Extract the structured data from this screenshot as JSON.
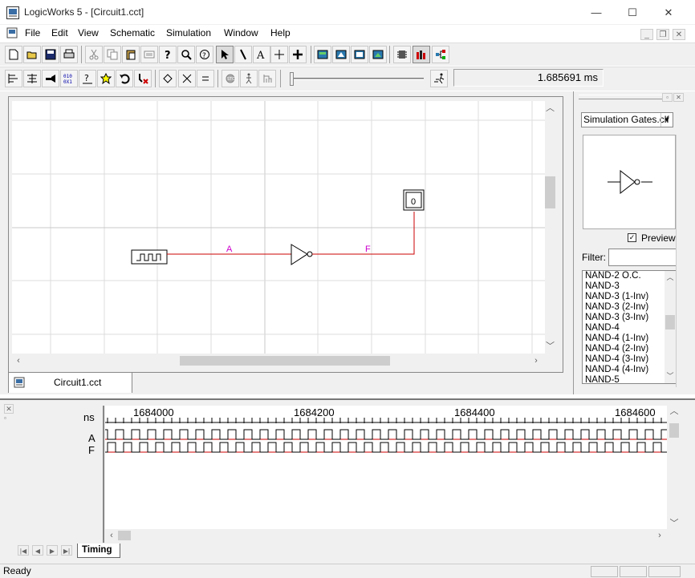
{
  "window": {
    "title": "LogicWorks 5 - [Circuit1.cct]",
    "minimize_label": "—",
    "maximize_label": "☐",
    "close_label": "✕"
  },
  "menu": {
    "items": [
      "File",
      "Edit",
      "View",
      "Schematic",
      "Simulation",
      "Window",
      "Help"
    ]
  },
  "mdi_controls": [
    "_",
    "❐",
    "✕"
  ],
  "toolbar1": {
    "buttons": [
      "new-icon",
      "open-icon",
      "save-icon",
      "print-icon",
      "cut-icon",
      "copy-icon",
      "paste-icon",
      "paste-special-icon",
      "help-icon",
      "zoom-icon",
      "context-help-icon",
      "pointer-icon",
      "pen-icon",
      "text-icon",
      "crosshair-icon",
      "plus-icon",
      "part-palette-icon",
      "simulation-view-icon",
      "timing-view-icon",
      "diagram-icon",
      "chip-icon",
      "bar-icon",
      "network-icon"
    ]
  },
  "toolbar2": {
    "buttons": [
      "align-left-icon",
      "align-icon",
      "probe-icon",
      "binary-display-icon",
      "clock-icon",
      "star-icon",
      "undo-icon",
      "delete-icon",
      "diamond-icon",
      "x-icon",
      "equals-icon",
      "stop-icon",
      "walk-icon",
      "step-icon",
      "run-icon"
    ],
    "sim_time": "1.685691 ms"
  },
  "circuit": {
    "tab_label": "Circuit1.cct",
    "wire_a_label": "A",
    "wire_f_label": "F",
    "probe_value": "0",
    "wire_color": "#cc0000",
    "label_color": "#cc00cc"
  },
  "library": {
    "selected": "Simulation Gates.clf",
    "preview_label": "Preview",
    "preview_checked": true,
    "filter_label": "Filter:",
    "filter_value": "",
    "items": [
      "NAND-2 O.C.",
      "NAND-3",
      "NAND-3 (1-Inv)",
      "NAND-3 (2-Inv)",
      "NAND-3 (3-Inv)",
      "NAND-4",
      "NAND-4 (1-Inv)",
      "NAND-4 (2-Inv)",
      "NAND-4 (3-Inv)",
      "NAND-4 (4-Inv)",
      "NAND-5"
    ]
  },
  "timing": {
    "unit": "ns",
    "ruler_labels": [
      "1684000",
      "1684200",
      "1684400",
      "1684600"
    ],
    "signals": [
      "A",
      "F"
    ],
    "tab_label": "Timing",
    "clock_period_ns": 20
  },
  "status": {
    "text": "Ready"
  }
}
